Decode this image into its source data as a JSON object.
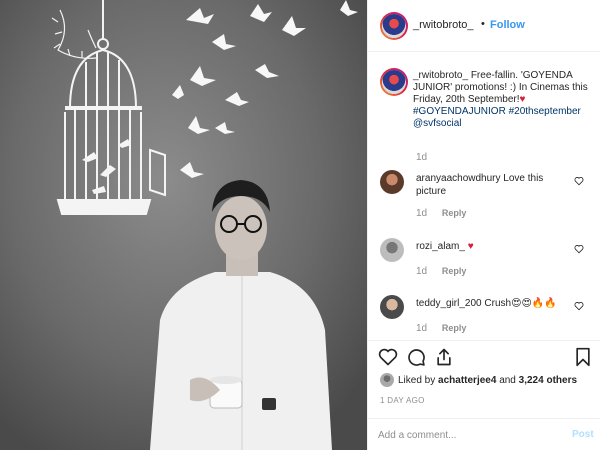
{
  "post": {
    "author": "_rwitobroto_",
    "follow_separator": "•",
    "follow_label": "Follow",
    "caption": {
      "username": "_rwitobroto_",
      "text_1": "Free-fallin. 'GOYENDA JUNIOR' promotions! :) In Cinemas this Friday, 20th September!",
      "heart": "♥",
      "hashtag_1": "#GOYENDAJUNIOR",
      "hashtag_2": "#20thseptember",
      "mention": "@svfsocial",
      "time": "1d"
    },
    "comments": [
      {
        "username": "aranyaachowdhury",
        "text": "Love this picture",
        "time": "1d",
        "reply_label": "Reply"
      },
      {
        "username": "rozi_alam_",
        "text": "♥",
        "time": "1d",
        "reply_label": "Reply"
      },
      {
        "username": "teddy_girl_200",
        "text": "Crush😍😍🔥🔥",
        "time": "1d",
        "reply_label": "Reply"
      }
    ],
    "likes": {
      "prefix": "Liked by",
      "user": "achatterjee4",
      "joiner": "and",
      "others": "3,224 others"
    },
    "date": "1 DAY AGO",
    "add_comment": {
      "placeholder": "Add a comment...",
      "post_label": "Post"
    }
  },
  "icons": {
    "actions": [
      "heart-icon",
      "comment-icon",
      "share-icon",
      "bookmark-icon"
    ],
    "comment_like": "heart-outline-icon"
  },
  "colors": {
    "link_blue": "#3897f0",
    "hashtag": "#003569",
    "secondary_text": "#8e8e8e",
    "post_disabled": "#b2dffc",
    "heart_red": "#d3203a"
  }
}
